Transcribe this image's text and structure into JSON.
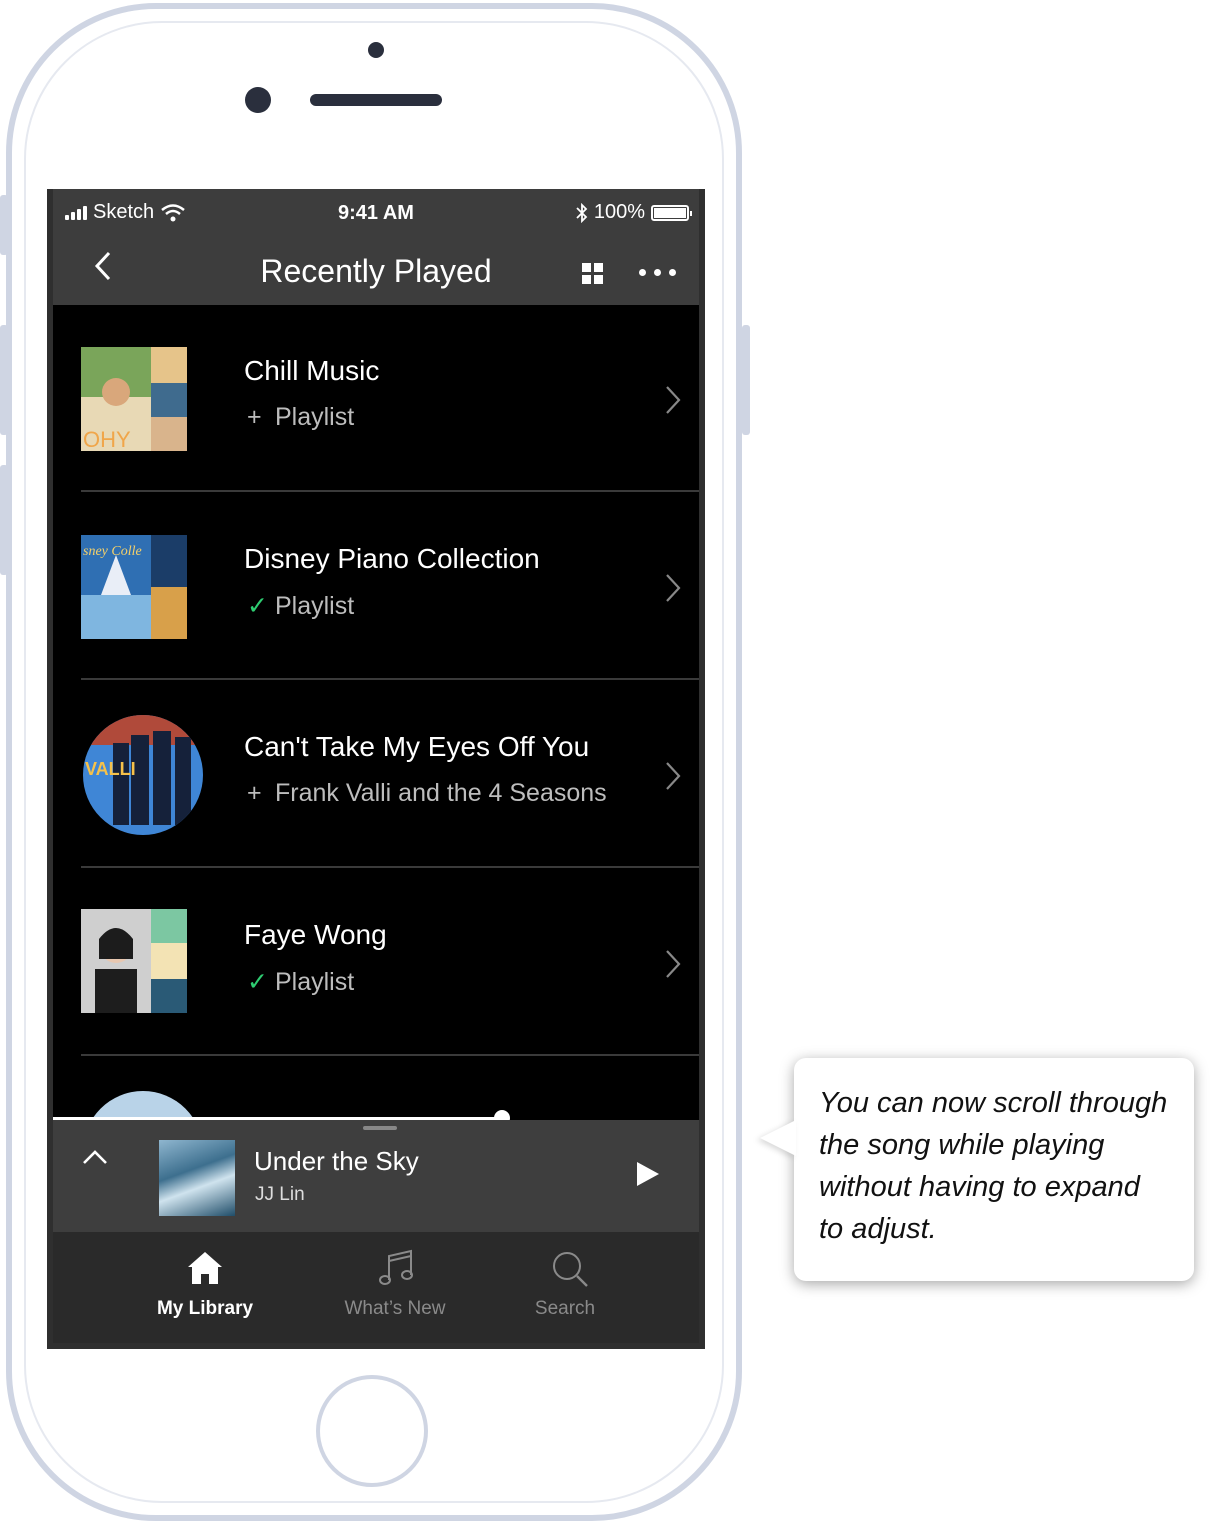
{
  "status": {
    "carrier": "Sketch",
    "time": "9:41 AM",
    "battery": "100%"
  },
  "header": {
    "title": "Recently Played"
  },
  "items": [
    {
      "name": "Chill Music",
      "marker": "+",
      "sub": "Playlist",
      "marker_color": "#bdbdbd"
    },
    {
      "name": "Disney Piano Collection",
      "marker": "✓",
      "sub": "Playlist",
      "marker_color": "#2ecc71"
    },
    {
      "name": "Can't Take My Eyes Off You",
      "marker": "+",
      "sub": "Frank Valli and the 4 Seasons",
      "marker_color": "#bdbdbd"
    },
    {
      "name": "Faye Wong",
      "marker": "✓",
      "sub": "Playlist",
      "marker_color": "#2ecc71"
    }
  ],
  "player": {
    "song": "Under the Sky",
    "artist": "JJ Lin",
    "progress": 0.69
  },
  "tabs": [
    {
      "label": "My Library",
      "active": true
    },
    {
      "label": "What’s New",
      "active": false
    },
    {
      "label": "Search",
      "active": false
    }
  ],
  "callout": {
    "text": "You can now scroll through the song while playing without having to expand to adjust."
  },
  "colors": {
    "accent_check": "#2ecc71",
    "background": "#000000",
    "bar": "#3d3d3d"
  }
}
